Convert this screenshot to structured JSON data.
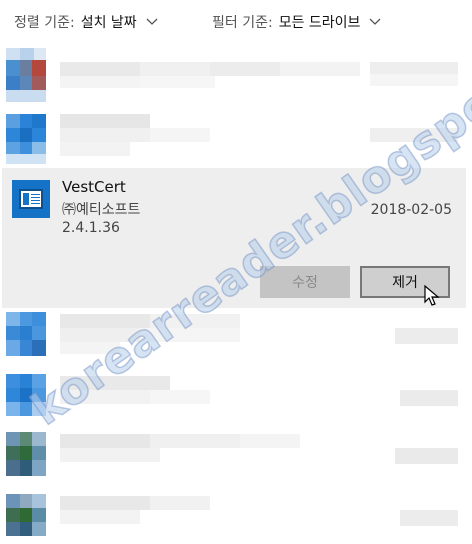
{
  "sort_filter": {
    "label": "정렬 기준:",
    "value": "설치 날짜"
  },
  "filter_filter": {
    "label": "필터 기준:",
    "value": "모든 드라이브"
  },
  "selected_app": {
    "name": "VestCert",
    "publisher": "㈜예티소프트",
    "version": "2.4.1.36",
    "install_date": "2018-02-05",
    "modify_label": "수정",
    "uninstall_label": "제거"
  },
  "watermark": "korearreader.blogspot.kr",
  "colors": {
    "accent": "#1473c6",
    "selected_bg": "#eeeeee"
  }
}
